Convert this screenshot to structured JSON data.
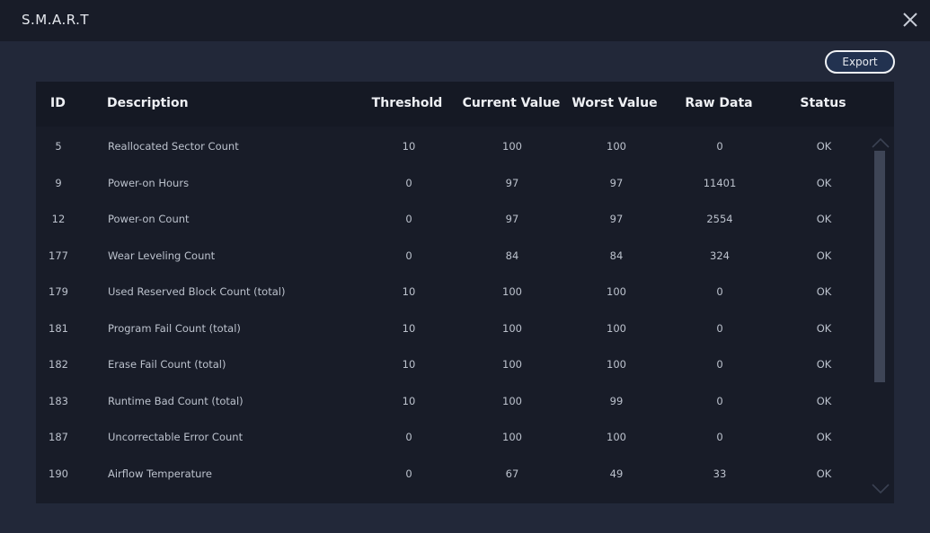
{
  "window": {
    "title": "S.M.A.R.T",
    "close_icon": "close-x-icon"
  },
  "toolbar": {
    "export_label": "Export"
  },
  "table": {
    "columns": [
      "ID",
      "Description",
      "Threshold",
      "Current Value",
      "Worst Value",
      "Raw Data",
      "Status"
    ],
    "rows": [
      {
        "id": "5",
        "description": "Reallocated Sector Count",
        "threshold": "10",
        "current": "100",
        "worst": "100",
        "raw": "0",
        "status": "OK"
      },
      {
        "id": "9",
        "description": "Power-on Hours",
        "threshold": "0",
        "current": "97",
        "worst": "97",
        "raw": "11401",
        "status": "OK"
      },
      {
        "id": "12",
        "description": "Power-on Count",
        "threshold": "0",
        "current": "97",
        "worst": "97",
        "raw": "2554",
        "status": "OK"
      },
      {
        "id": "177",
        "description": "Wear Leveling Count",
        "threshold": "0",
        "current": "84",
        "worst": "84",
        "raw": "324",
        "status": "OK"
      },
      {
        "id": "179",
        "description": "Used Reserved Block Count (total)",
        "threshold": "10",
        "current": "100",
        "worst": "100",
        "raw": "0",
        "status": "OK"
      },
      {
        "id": "181",
        "description": "Program Fail Count (total)",
        "threshold": "10",
        "current": "100",
        "worst": "100",
        "raw": "0",
        "status": "OK"
      },
      {
        "id": "182",
        "description": "Erase Fail Count (total)",
        "threshold": "10",
        "current": "100",
        "worst": "100",
        "raw": "0",
        "status": "OK"
      },
      {
        "id": "183",
        "description": "Runtime Bad Count (total)",
        "threshold": "10",
        "current": "100",
        "worst": "99",
        "raw": "0",
        "status": "OK"
      },
      {
        "id": "187",
        "description": "Uncorrectable Error Count",
        "threshold": "0",
        "current": "100",
        "worst": "100",
        "raw": "0",
        "status": "OK"
      },
      {
        "id": "190",
        "description": "Airflow Temperature",
        "threshold": "0",
        "current": "67",
        "worst": "49",
        "raw": "33",
        "status": "OK"
      }
    ]
  },
  "scrollbar": {
    "position_fraction": 0.0,
    "visible_fraction": 0.71
  },
  "colors": {
    "title_bg": "#181c28",
    "body_bg": "#222839",
    "panel_bg": "#181c28",
    "header_bg": "#151924",
    "export_bg": "#223250",
    "scroll_thumb": "#3e4556"
  }
}
